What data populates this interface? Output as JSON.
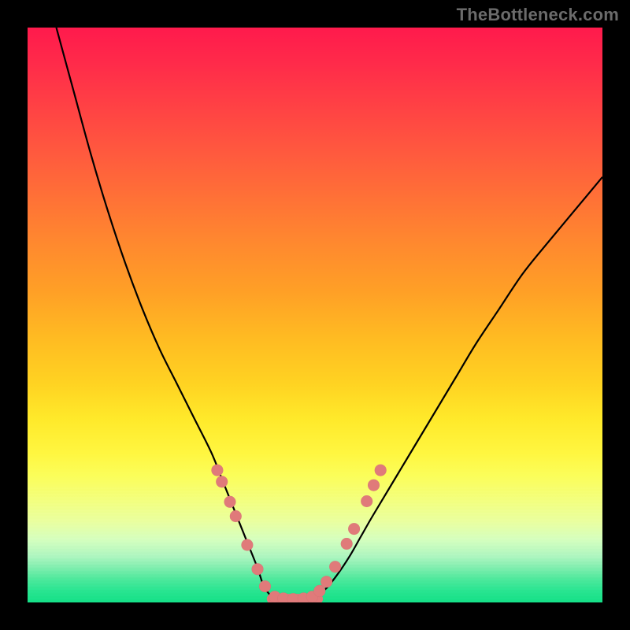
{
  "watermark": "TheBottleneck.com",
  "chart_data": {
    "type": "line",
    "title": "",
    "xlabel": "",
    "ylabel": "",
    "xlim": [
      0,
      100
    ],
    "ylim": [
      0,
      100
    ],
    "grid": false,
    "legend": false,
    "annotations": [],
    "series": [
      {
        "name": "left-curve",
        "x": [
          5,
          8,
          11,
          14,
          17,
          20,
          23,
          26,
          29,
          32,
          34,
          36,
          38,
          40,
          41,
          42,
          43
        ],
        "y": [
          100,
          89,
          78,
          68,
          59,
          51,
          44,
          38,
          32,
          26,
          21,
          16,
          11,
          6,
          3,
          1.5,
          0.8
        ]
      },
      {
        "name": "right-curve",
        "x": [
          50,
          52,
          54,
          56,
          58,
          60,
          63,
          66,
          69,
          72,
          75,
          78,
          82,
          86,
          90,
          95,
          100
        ],
        "y": [
          1,
          2.5,
          5,
          8,
          11.5,
          15,
          20,
          25,
          30,
          35,
          40,
          45,
          51,
          57,
          62,
          68,
          74
        ]
      },
      {
        "name": "floor",
        "x": [
          42.5,
          50.5
        ],
        "y": [
          0.6,
          0.6
        ]
      }
    ],
    "markers": {
      "name": "highlighted-points",
      "color": "#e07a7a",
      "points": [
        {
          "x": 33.0,
          "y": 23.0
        },
        {
          "x": 33.8,
          "y": 21.0
        },
        {
          "x": 35.2,
          "y": 17.5
        },
        {
          "x": 36.2,
          "y": 15.0
        },
        {
          "x": 38.2,
          "y": 10.0
        },
        {
          "x": 40.0,
          "y": 5.8
        },
        {
          "x": 41.3,
          "y": 2.8
        },
        {
          "x": 43.0,
          "y": 1.0
        },
        {
          "x": 44.5,
          "y": 0.7
        },
        {
          "x": 46.2,
          "y": 0.6
        },
        {
          "x": 48.0,
          "y": 0.7
        },
        {
          "x": 49.5,
          "y": 1.0
        },
        {
          "x": 50.8,
          "y": 2.0
        },
        {
          "x": 52.0,
          "y": 3.6
        },
        {
          "x": 53.5,
          "y": 6.2
        },
        {
          "x": 55.5,
          "y": 10.2
        },
        {
          "x": 56.8,
          "y": 12.8
        },
        {
          "x": 59.0,
          "y": 17.6
        },
        {
          "x": 60.2,
          "y": 20.4
        },
        {
          "x": 61.4,
          "y": 23.0
        }
      ]
    },
    "gradient_stops": [
      {
        "pos": 0,
        "color": "#ff1a4c"
      },
      {
        "pos": 50,
        "color": "#ffd322"
      },
      {
        "pos": 80,
        "color": "#f4ff7c"
      },
      {
        "pos": 100,
        "color": "#14e187"
      }
    ]
  }
}
